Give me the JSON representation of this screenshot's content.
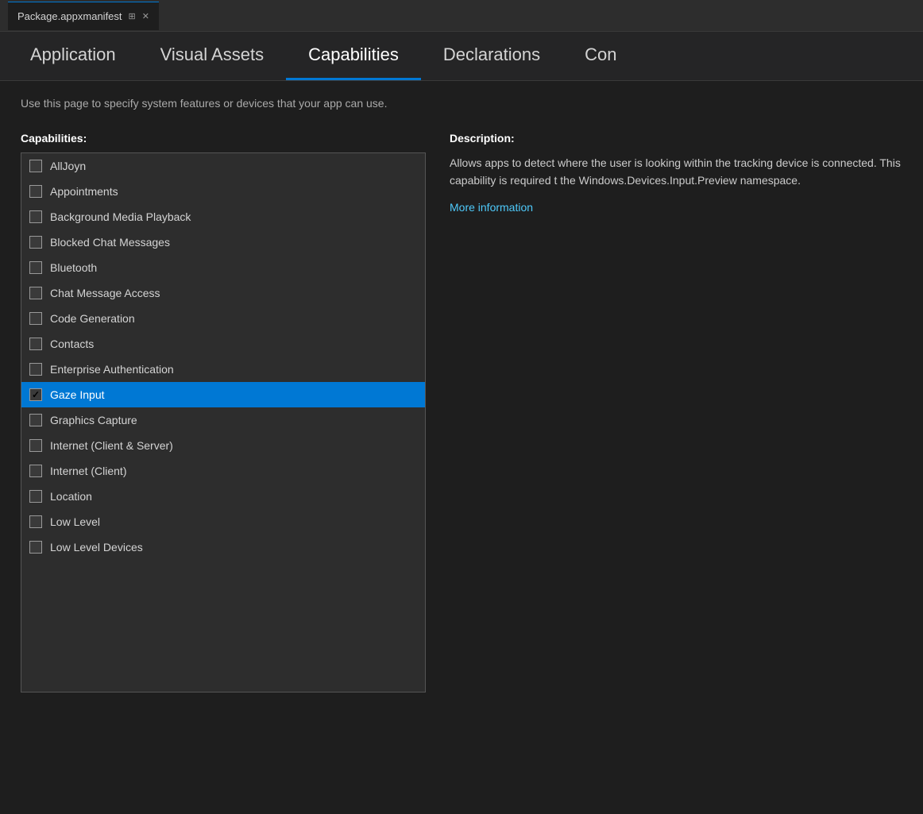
{
  "titleBar": {
    "tabName": "Package.appxmanifest",
    "pinLabel": "⊞",
    "closeLabel": "✕"
  },
  "navTabs": [
    {
      "id": "application",
      "label": "Application"
    },
    {
      "id": "visual-assets",
      "label": "Visual Assets"
    },
    {
      "id": "capabilities",
      "label": "Capabilities"
    },
    {
      "id": "declarations",
      "label": "Declarations"
    },
    {
      "id": "con",
      "label": "Con"
    }
  ],
  "activeTab": "capabilities",
  "page": {
    "description": "Use this page to specify system features or devices that your app can use.",
    "capabilitiesTitle": "Capabilities:",
    "descriptionTitle": "Description:",
    "descriptionText": "Allows apps to detect where the user is looking within the tracking device is connected. This capability is required t the Windows.Devices.Input.Preview namespace.",
    "moreInfoLabel": "More information"
  },
  "capabilities": [
    {
      "id": "alljoyn",
      "label": "AllJoyn",
      "checked": false,
      "selected": false
    },
    {
      "id": "appointments",
      "label": "Appointments",
      "checked": false,
      "selected": false
    },
    {
      "id": "background-media-playback",
      "label": "Background Media Playback",
      "checked": false,
      "selected": false
    },
    {
      "id": "blocked-chat-messages",
      "label": "Blocked Chat Messages",
      "checked": false,
      "selected": false
    },
    {
      "id": "bluetooth",
      "label": "Bluetooth",
      "checked": false,
      "selected": false
    },
    {
      "id": "chat-message-access",
      "label": "Chat Message Access",
      "checked": false,
      "selected": false
    },
    {
      "id": "code-generation",
      "label": "Code Generation",
      "checked": false,
      "selected": false
    },
    {
      "id": "contacts",
      "label": "Contacts",
      "checked": false,
      "selected": false
    },
    {
      "id": "enterprise-authentication",
      "label": "Enterprise Authentication",
      "checked": false,
      "selected": false
    },
    {
      "id": "gaze-input",
      "label": "Gaze Input",
      "checked": true,
      "selected": true
    },
    {
      "id": "graphics-capture",
      "label": "Graphics Capture",
      "checked": false,
      "selected": false
    },
    {
      "id": "internet-client-server",
      "label": "Internet (Client & Server)",
      "checked": false,
      "selected": false
    },
    {
      "id": "internet-client",
      "label": "Internet (Client)",
      "checked": false,
      "selected": false
    },
    {
      "id": "location",
      "label": "Location",
      "checked": false,
      "selected": false
    },
    {
      "id": "low-level",
      "label": "Low Level",
      "checked": false,
      "selected": false
    },
    {
      "id": "low-level-devices",
      "label": "Low Level Devices",
      "checked": false,
      "selected": false
    }
  ]
}
